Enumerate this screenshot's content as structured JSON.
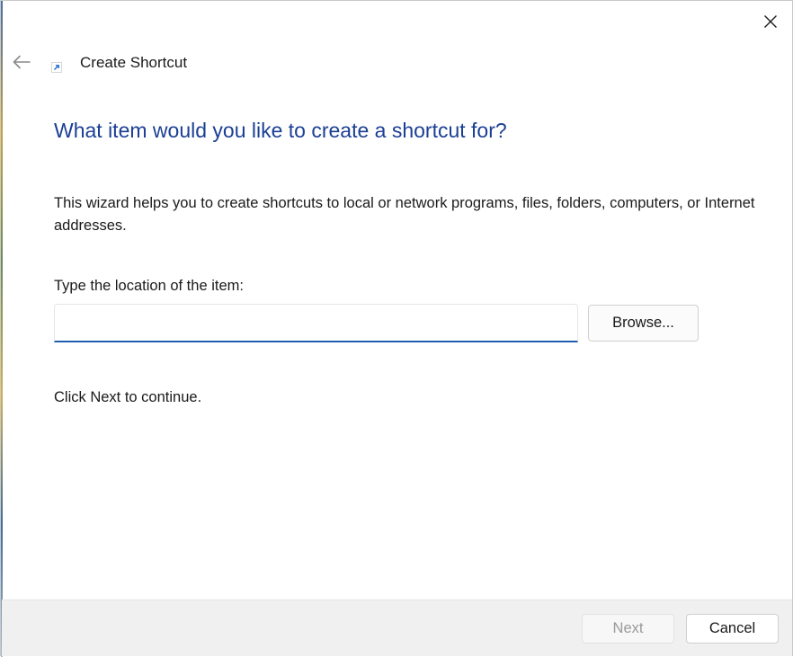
{
  "window": {
    "title": "Create Shortcut",
    "close_icon": "close-icon",
    "back_icon": "arrow-left-icon",
    "app_icon": "shortcut-arrow-icon"
  },
  "main": {
    "heading": "What item would you like to create a shortcut for?",
    "description": "This wizard helps you to create shortcuts to local or network programs, files, folders, computers, or Internet addresses.",
    "location_label": "Type the location of the item:",
    "location_value": "",
    "browse_label": "Browse...",
    "continue_text": "Click Next to continue."
  },
  "footer": {
    "next_label": "Next",
    "next_enabled": false,
    "cancel_label": "Cancel"
  },
  "colors": {
    "heading": "#1b3f94",
    "accent": "#1f5fae",
    "footer_bg": "#f0f0f0",
    "disabled_text": "#9a9a9a"
  }
}
